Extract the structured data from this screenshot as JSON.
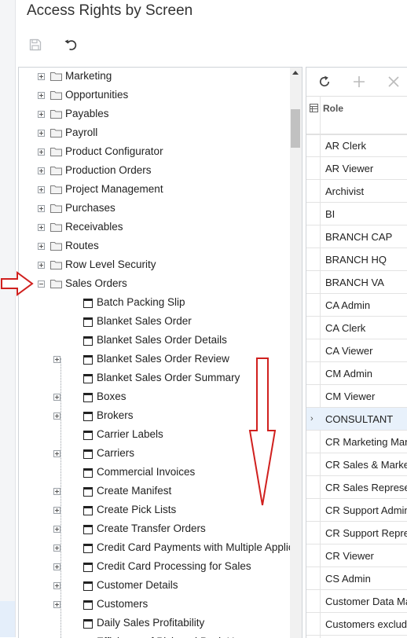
{
  "page": {
    "title": "Access Rights by Screen"
  },
  "toolbar": {
    "save_icon": "save-icon",
    "undo_icon": "undo-icon"
  },
  "tree": {
    "items": [
      {
        "label": "Marketing",
        "kind": "folder",
        "level": 0,
        "expander": "plus"
      },
      {
        "label": "Opportunities",
        "kind": "folder",
        "level": 0,
        "expander": "plus"
      },
      {
        "label": "Payables",
        "kind": "folder",
        "level": 0,
        "expander": "plus"
      },
      {
        "label": "Payroll",
        "kind": "folder",
        "level": 0,
        "expander": "plus"
      },
      {
        "label": "Product Configurator",
        "kind": "folder",
        "level": 0,
        "expander": "plus"
      },
      {
        "label": "Production Orders",
        "kind": "folder",
        "level": 0,
        "expander": "plus"
      },
      {
        "label": "Project Management",
        "kind": "folder",
        "level": 0,
        "expander": "plus"
      },
      {
        "label": "Purchases",
        "kind": "folder",
        "level": 0,
        "expander": "plus"
      },
      {
        "label": "Receivables",
        "kind": "folder",
        "level": 0,
        "expander": "plus"
      },
      {
        "label": "Routes",
        "kind": "folder",
        "level": 0,
        "expander": "plus"
      },
      {
        "label": "Row Level Security",
        "kind": "folder",
        "level": 0,
        "expander": "plus"
      },
      {
        "label": "Sales Orders",
        "kind": "folder",
        "level": 0,
        "expander": "minus"
      },
      {
        "label": "Batch Packing Slip",
        "kind": "screen",
        "level": 1,
        "expander": ""
      },
      {
        "label": "Blanket Sales Order",
        "kind": "screen",
        "level": 1,
        "expander": ""
      },
      {
        "label": "Blanket Sales Order Details",
        "kind": "screen",
        "level": 1,
        "expander": ""
      },
      {
        "label": "Blanket Sales Order Review",
        "kind": "screen",
        "level": 1,
        "expander": "plus"
      },
      {
        "label": "Blanket Sales Order Summary",
        "kind": "screen",
        "level": 1,
        "expander": ""
      },
      {
        "label": "Boxes",
        "kind": "screen",
        "level": 1,
        "expander": "plus"
      },
      {
        "label": "Brokers",
        "kind": "screen",
        "level": 1,
        "expander": "plus"
      },
      {
        "label": "Carrier Labels",
        "kind": "screen",
        "level": 1,
        "expander": ""
      },
      {
        "label": "Carriers",
        "kind": "screen",
        "level": 1,
        "expander": "plus"
      },
      {
        "label": "Commercial Invoices",
        "kind": "screen",
        "level": 1,
        "expander": ""
      },
      {
        "label": "Create Manifest",
        "kind": "screen",
        "level": 1,
        "expander": "plus"
      },
      {
        "label": "Create Pick Lists",
        "kind": "screen",
        "level": 1,
        "expander": "plus"
      },
      {
        "label": "Create Transfer Orders",
        "kind": "screen",
        "level": 1,
        "expander": "plus"
      },
      {
        "label": "Credit Card Payments with Multiple Applications",
        "kind": "screen",
        "level": 1,
        "expander": "plus"
      },
      {
        "label": "Credit Card Processing for Sales",
        "kind": "screen",
        "level": 1,
        "expander": "plus"
      },
      {
        "label": "Customer Details",
        "kind": "screen",
        "level": 1,
        "expander": "plus"
      },
      {
        "label": "Customers",
        "kind": "screen",
        "level": 1,
        "expander": "plus"
      },
      {
        "label": "Daily Sales Profitability",
        "kind": "screen",
        "level": 1,
        "expander": ""
      },
      {
        "label": "Efficiency of Pick and Pack Users",
        "kind": "screen",
        "level": 1,
        "expander": "plus"
      }
    ]
  },
  "grid": {
    "toolbar": {
      "refresh_icon": "refresh-icon",
      "add_icon": "add-icon",
      "delete_icon": "delete-icon"
    },
    "column_header": "Role",
    "rows": [
      {
        "role": "",
        "selected": false
      },
      {
        "role": "AR Clerk",
        "selected": false
      },
      {
        "role": "AR Viewer",
        "selected": false
      },
      {
        "role": "Archivist",
        "selected": false
      },
      {
        "role": "BI",
        "selected": false
      },
      {
        "role": "BRANCH CAP",
        "selected": false
      },
      {
        "role": "BRANCH HQ",
        "selected": false
      },
      {
        "role": "BRANCH VA",
        "selected": false
      },
      {
        "role": "CA Admin",
        "selected": false
      },
      {
        "role": "CA Clerk",
        "selected": false
      },
      {
        "role": "CA Viewer",
        "selected": false
      },
      {
        "role": "CM Admin",
        "selected": false
      },
      {
        "role": "CM Viewer",
        "selected": false
      },
      {
        "role": "CONSULTANT",
        "selected": true
      },
      {
        "role": "CR Marketing Manager",
        "selected": false
      },
      {
        "role": "CR Sales & Marketing",
        "selected": false
      },
      {
        "role": "CR Sales Representative",
        "selected": false
      },
      {
        "role": "CR Support Admin",
        "selected": false
      },
      {
        "role": "CR Support Representative",
        "selected": false
      },
      {
        "role": "CR Viewer",
        "selected": false
      },
      {
        "role": "CS Admin",
        "selected": false
      },
      {
        "role": "Customer Data Manager",
        "selected": false
      },
      {
        "role": "Customers excluded",
        "selected": false
      }
    ]
  },
  "colors": {
    "annotation": "#d0201e",
    "selected_row": "#e8f1fb"
  }
}
